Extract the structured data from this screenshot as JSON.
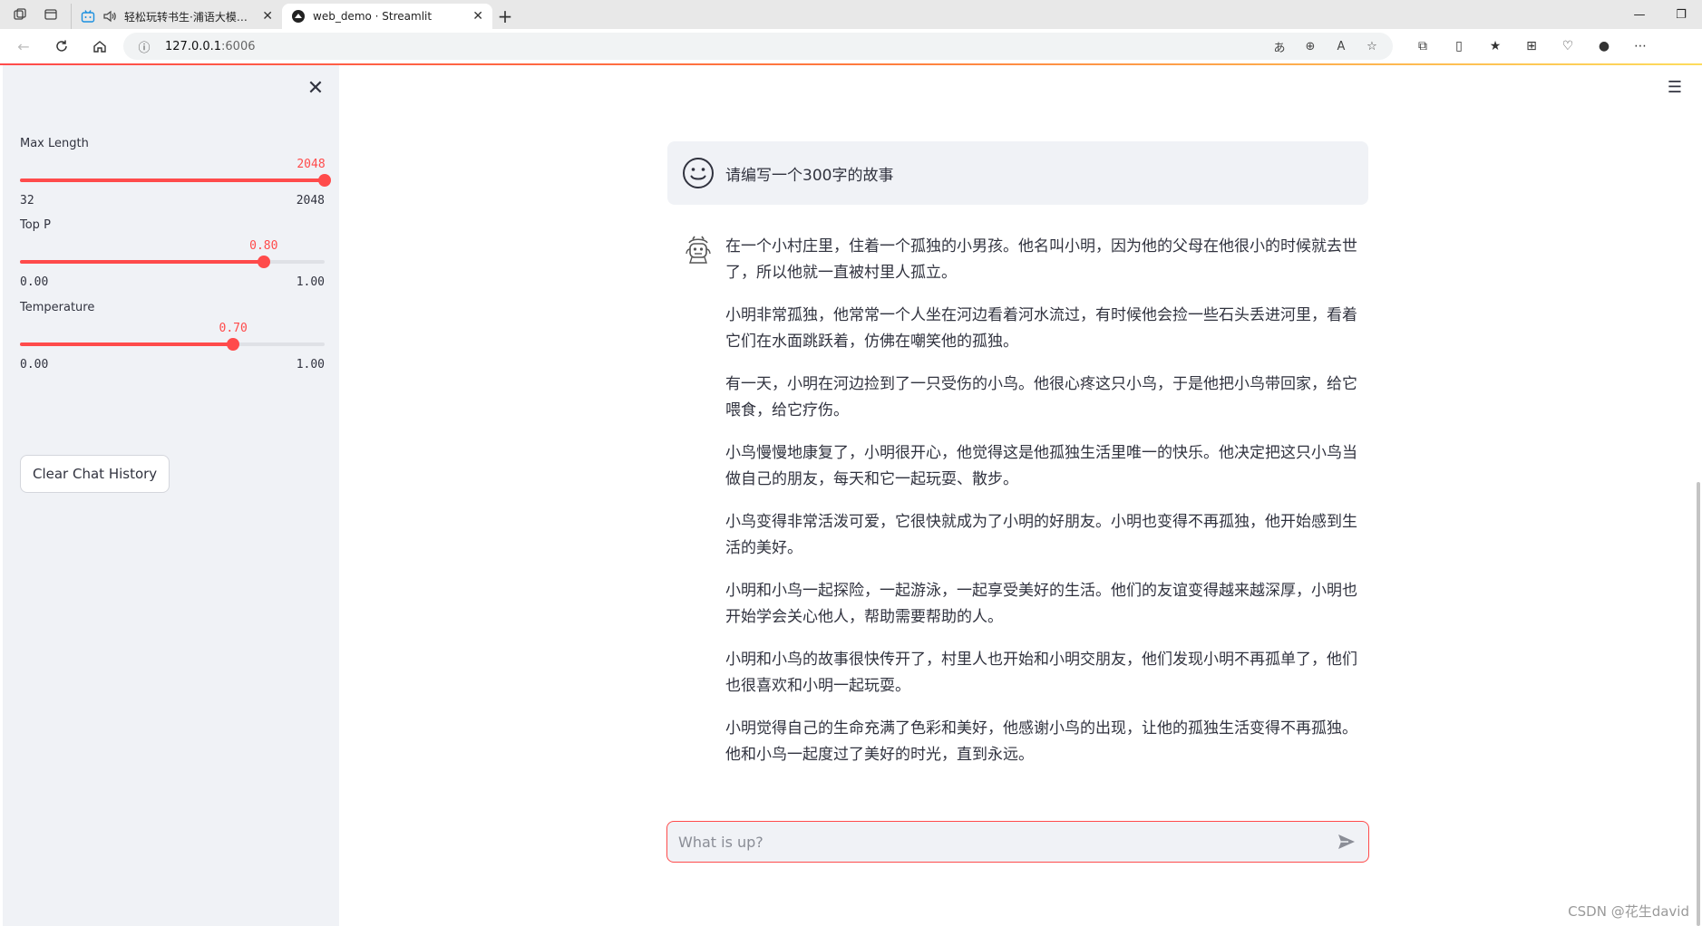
{
  "browser": {
    "tabs": [
      {
        "title": "轻松玩转书生·浦语大模型趣",
        "active": false
      },
      {
        "title": "web_demo · Streamlit",
        "active": true
      }
    ],
    "url_host": "127.0.0.1",
    "url_port": ":6006"
  },
  "sidebar": {
    "sliders": [
      {
        "label": "Max Length",
        "value_text": "2048",
        "min_text": "32",
        "max_text": "2048",
        "value": 2048,
        "min": 32,
        "max": 2048
      },
      {
        "label": "Top P",
        "value_text": "0.80",
        "min_text": "0.00",
        "max_text": "1.00",
        "value": 0.8,
        "min": 0,
        "max": 1
      },
      {
        "label": "Temperature",
        "value_text": "0.70",
        "min_text": "0.00",
        "max_text": "1.00",
        "value": 0.7,
        "min": 0,
        "max": 1
      }
    ],
    "clear_button": "Clear Chat History"
  },
  "chat": {
    "user_message": "请编写一个300字的故事",
    "bot_paragraphs": [
      "在一个小村庄里，住着一个孤独的小男孩。他名叫小明，因为他的父母在他很小的时候就去世了，所以他就一直被村里人孤立。",
      "小明非常孤独，他常常一个人坐在河边看着河水流过，有时候他会捡一些石头丢进河里，看着它们在水面跳跃着，仿佛在嘲笑他的孤独。",
      "有一天，小明在河边捡到了一只受伤的小鸟。他很心疼这只小鸟，于是他把小鸟带回家，给它喂食，给它疗伤。",
      "小鸟慢慢地康复了，小明很开心，他觉得这是他孤独生活里唯一的快乐。他决定把这只小鸟当做自己的朋友，每天和它一起玩耍、散步。",
      "小鸟变得非常活泼可爱，它很快就成为了小明的好朋友。小明也变得不再孤独，他开始感到生活的美好。",
      "小明和小鸟一起探险，一起游泳，一起享受美好的生活。他们的友谊变得越来越深厚，小明也开始学会关心他人，帮助需要帮助的人。",
      "小明和小鸟的故事很快传开了，村里人也开始和小明交朋友，他们发现小明不再孤单了，他们也很喜欢和小明一起玩耍。",
      "小明觉得自己的生命充满了色彩和美好，他感谢小鸟的出现，让他的孤独生活变得不再孤独。他和小鸟一起度过了美好的时光，直到永远。"
    ],
    "input_placeholder": "What is up?"
  },
  "watermark": "CSDN @花生david",
  "colors": {
    "accent": "#ff4b4b",
    "sidebar_bg": "#f0f2f6",
    "text": "#31333f"
  }
}
